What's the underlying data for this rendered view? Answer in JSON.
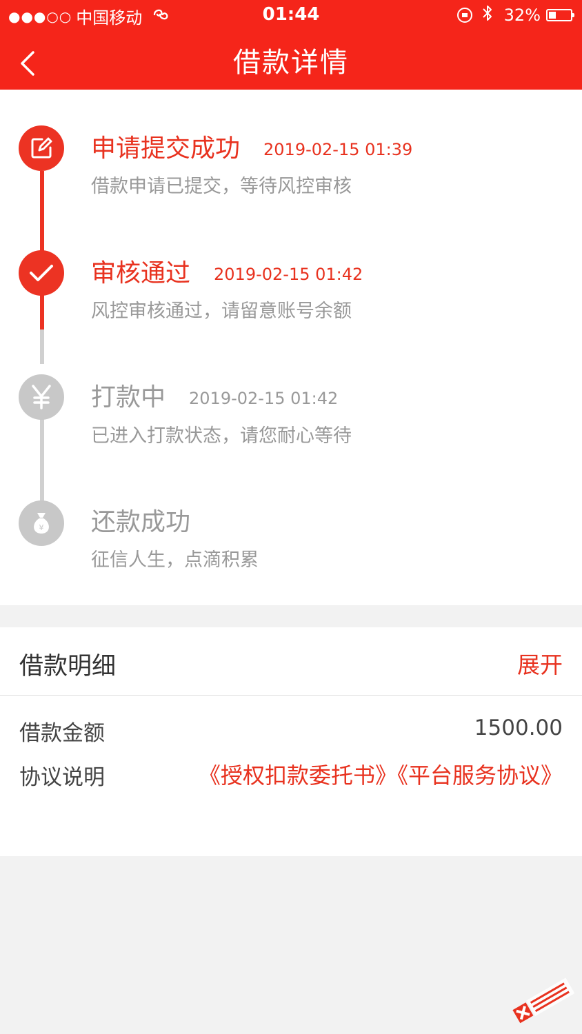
{
  "status_bar": {
    "signal": "●●●○○",
    "carrier": "中国移动",
    "time": "01:44",
    "battery_pct": "32%",
    "battery_level": 0.32
  },
  "header": {
    "title": "借款详情"
  },
  "timeline": [
    {
      "title": "申请提交成功",
      "time": "2019-02-15 01:39",
      "desc": "借款申请已提交，等待风控审核",
      "icon": "edit-icon",
      "state": "done"
    },
    {
      "title": "审核通过",
      "time": "2019-02-15 01:42",
      "desc": "风控审核通过，请留意账号余额",
      "icon": "check-icon",
      "state": "done"
    },
    {
      "title": "打款中",
      "time": "2019-02-15 01:42",
      "desc": "已进入打款状态，请您耐心等待",
      "icon": "yen-icon",
      "state": "pending"
    },
    {
      "title": "还款成功",
      "time": "",
      "desc": "征信人生，点滴积累",
      "icon": "money-bag-icon",
      "state": "pending"
    }
  ],
  "details": {
    "title": "借款明细",
    "expand_label": "展开",
    "amount_label": "借款金额",
    "amount_value": "1500.00",
    "agreement_label": "协议说明",
    "agreement_1": "《授权扣款委托书》",
    "agreement_2": "《平台服务协议》"
  },
  "colors": {
    "brand": "#f5251a",
    "accent": "#e8321f",
    "inactive": "#c8c8c8"
  }
}
